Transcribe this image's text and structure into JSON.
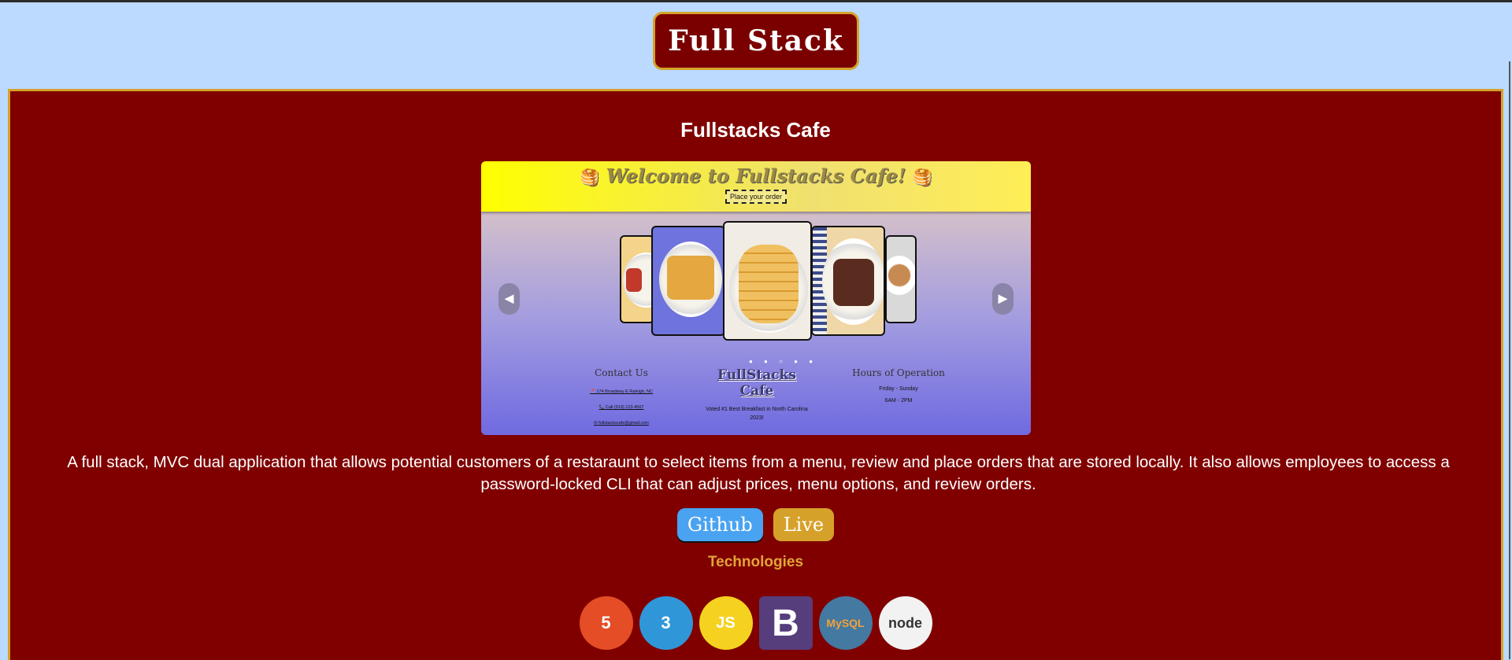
{
  "header": {
    "title": "Full Stack"
  },
  "project": {
    "title": "Fullstacks Cafe",
    "description": "A full stack, MVC dual application that allows potential customers of a restaraunt to select items from a menu, review and place orders that are stored locally. It also allows employees to access a password-locked CLI that can adjust prices, menu options, and review orders.",
    "links": {
      "github_label": "Github",
      "live_label": "Live"
    },
    "technologies_heading": "Technologies",
    "technologies": [
      {
        "name": "html5-icon",
        "label": "HTML",
        "glyph": "5",
        "color": "#e44d26"
      },
      {
        "name": "css3-icon",
        "label": "CSS",
        "glyph": "3",
        "color": "#2f97d8"
      },
      {
        "name": "javascript-icon",
        "label": "JS",
        "glyph": "JS",
        "color": "#f5d21f"
      },
      {
        "name": "bootstrap-icon",
        "label": "B",
        "glyph": "B",
        "color": "#563d7c"
      },
      {
        "name": "mysql-icon",
        "label": "MySQL",
        "glyph": "MySQL",
        "color": "#4479a1"
      },
      {
        "name": "nodejs-icon",
        "label": "node",
        "glyph": "node",
        "color": "#f2f2f2"
      }
    ]
  },
  "preview": {
    "welcome": "Welcome to Fullstacks Cafe!",
    "order_button": "Place your order",
    "contact_heading": "Contact Us",
    "address": "174 Broadway E Raleigh, NC",
    "phone": "Call (919) 123-4567",
    "email": "fullstackscafe@gmail.com",
    "brand": "FullStacks Cafe",
    "tagline": "Voted #1 Best Breakfast in North Carolina 2023!",
    "hours_heading": "Hours of Operation",
    "hours_days": "Friday - Sunday",
    "hours_time": "6AM - 2PM"
  }
}
